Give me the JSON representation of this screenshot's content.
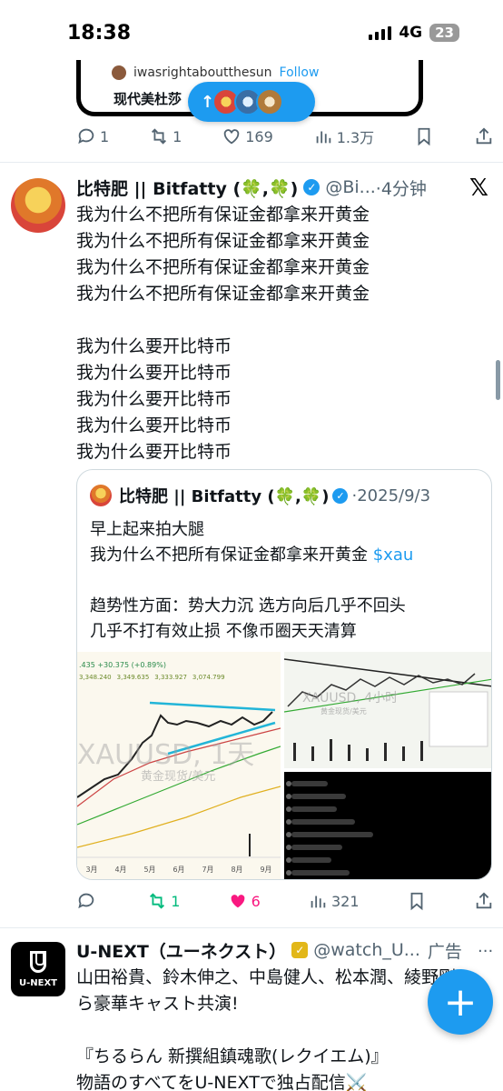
{
  "status_bar": {
    "time": "18:38",
    "network": "4G",
    "battery": "23"
  },
  "prev_post": {
    "embed_username": "iwasrightaboutthesun",
    "embed_follow": "Follow",
    "embed_text": "现代美杜莎",
    "replies": "1",
    "reposts": "1",
    "likes": "169",
    "views": "1.3万"
  },
  "new_posts_pill": {
    "arrow": "↑"
  },
  "post": {
    "display_name": "比特肥 || Bitfatty (🍀,🍀)",
    "handle": "@Bi...",
    "time": "·4分钟",
    "lines": [
      "我为什么不把所有保证金都拿来开黄金",
      "我为什么不把所有保证金都拿来开黄金",
      "我为什么不把所有保证金都拿来开黄金",
      "我为什么不把所有保证金都拿来开黄金",
      "",
      "我为什么要开比特币",
      "我为什么要开比特币",
      "我为什么要开比特币",
      "我为什么要开比特币",
      "我为什么要开比特币"
    ],
    "replies": "",
    "reposts": "1",
    "likes": "6",
    "views": "321",
    "colors": {
      "repost": "#00ba7c",
      "like": "#f91880"
    }
  },
  "quote": {
    "display_name": "比特肥 || Bitfatty (🍀,🍀)",
    "date": "·2025/9/3",
    "line1": "早上起来拍大腿",
    "line2_text": "我为什么不把所有保证金都拿来开黄金 ",
    "line2_cashtag": "$xau",
    "line3": "趋势性方面：势大力沉 选方向后几乎不回头",
    "line4": "几乎不打有效止损 不像币圈天天清算",
    "image1": {
      "header": ".435 +30.375 (+0.89%)",
      "prices": [
        "3,348.240",
        "3,349.635",
        "3,333.927",
        "3,074.799"
      ],
      "watermark": "XAUUSD, 1天",
      "watermark_sub": "黄金现货/美元",
      "months": [
        "3月",
        "4月",
        "5月",
        "6月",
        "7月",
        "8月",
        "9月"
      ]
    },
    "image2": {
      "watermark": "XAUUSD, 4小时",
      "watermark_sub": "黄金现货/美元"
    }
  },
  "ad": {
    "logo_label": "U-NEXT",
    "display_name": "U-NEXT（ユーネクスト）",
    "handle": "@watch_U...",
    "tag": "广告",
    "more": "···",
    "lines": [
      "山田裕貴、鈴木伸之、中島健人、松本潤、綾野剛",
      "ら豪華キャスト共演!",
      "",
      "『ちるらん 新撰組鎮魂歌(レクイエム)』",
      "物語のすべてをU-NEXTで独占配信⚔️"
    ]
  },
  "fab": {
    "label": "+"
  },
  "colors": {
    "accent": "#1d9bf0",
    "text": "#0f1419",
    "muted": "#536471"
  }
}
